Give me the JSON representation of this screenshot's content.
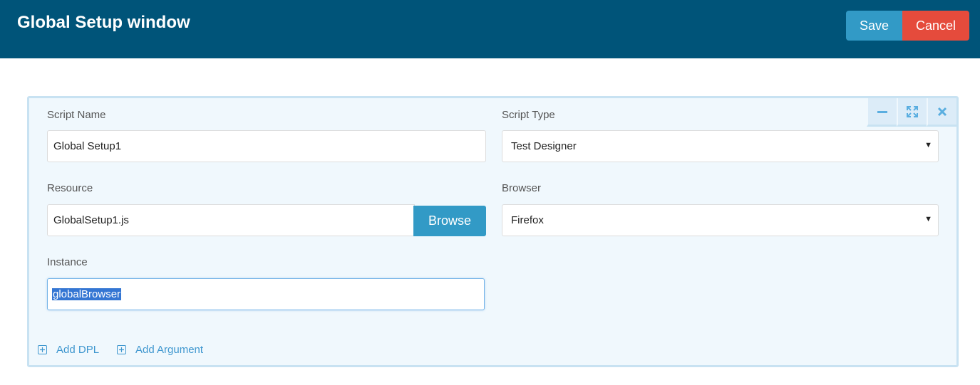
{
  "header": {
    "title": "Global Setup window",
    "save_label": "Save",
    "cancel_label": "Cancel"
  },
  "panel": {
    "controls": [
      "minimize-icon",
      "expand-icon",
      "close-icon"
    ],
    "script_name": {
      "label": "Script Name",
      "value": "Global Setup1"
    },
    "script_type": {
      "label": "Script Type",
      "value": "Test Designer"
    },
    "resource": {
      "label": "Resource",
      "value": "GlobalSetup1.js",
      "browse_label": "Browse"
    },
    "browser": {
      "label": "Browser",
      "value": "Firefox"
    },
    "instance": {
      "label": "Instance",
      "value": "globalBrowser"
    },
    "links": {
      "add_dpl": "Add DPL",
      "add_argument": "Add Argument"
    }
  },
  "colors": {
    "header_bg": "#005479",
    "save": "#329ac6",
    "cancel": "#e54b3c",
    "panel_bg": "#f0f8fd",
    "link": "#3f97cf"
  }
}
